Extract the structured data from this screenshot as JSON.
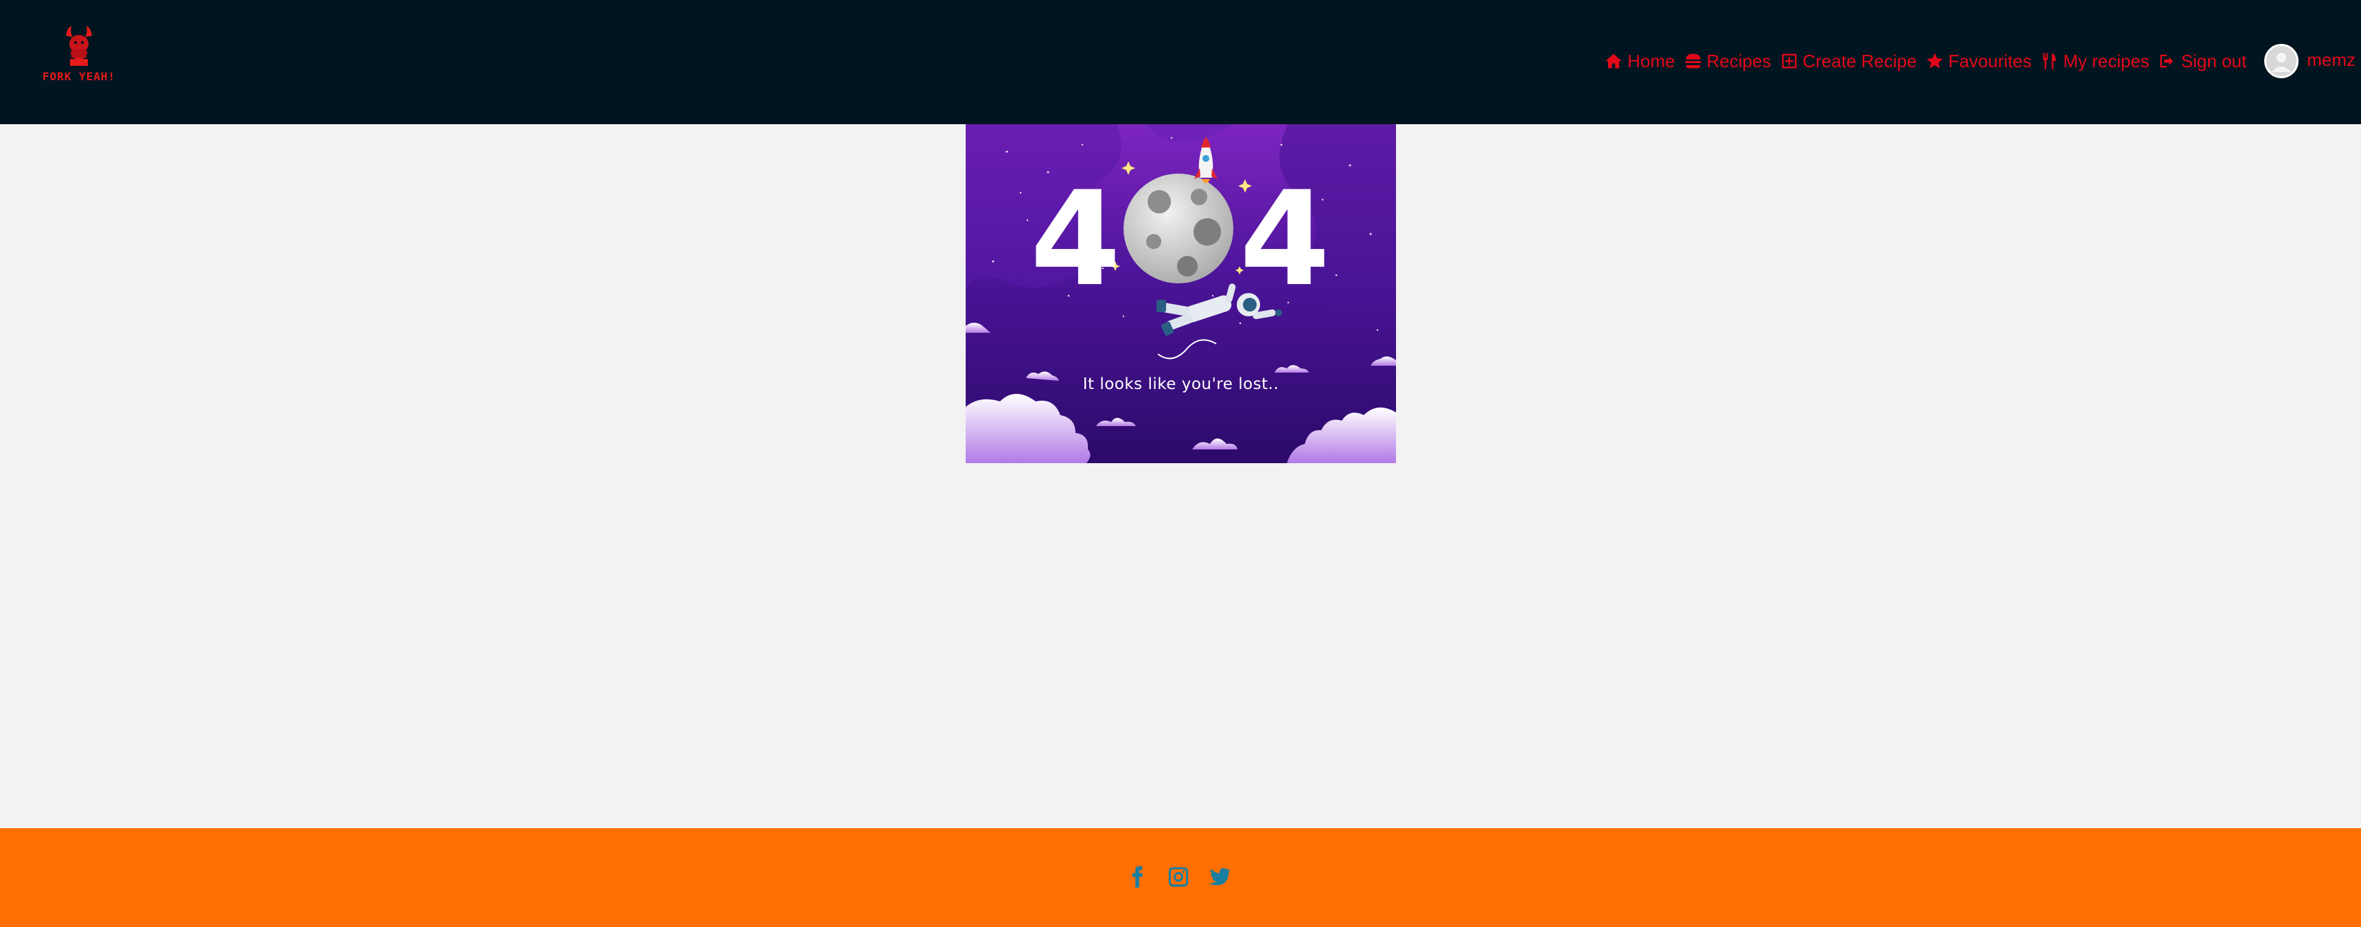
{
  "header": {
    "logo_text": "FORK YEAH!",
    "nav": [
      {
        "label": "Home",
        "icon": "home-icon"
      },
      {
        "label": "Recipes",
        "icon": "burger-icon"
      },
      {
        "label": "Create Recipe",
        "icon": "plus-square-icon"
      },
      {
        "label": "Favourites",
        "icon": "star-icon"
      },
      {
        "label": "My recipes",
        "icon": "utensils-icon"
      },
      {
        "label": "Sign out",
        "icon": "sign-out-icon"
      }
    ],
    "user": {
      "name": "memz",
      "avatar_icon": "user-avatar-icon"
    }
  },
  "notfound": {
    "digit_left": "4",
    "digit_right": "4",
    "message": "It looks like you're lost.."
  },
  "footer": {
    "social": [
      {
        "icon": "facebook-icon"
      },
      {
        "icon": "instagram-icon"
      },
      {
        "icon": "twitter-icon"
      }
    ]
  },
  "colors": {
    "header_bg": "#001520",
    "accent": "#e3081a",
    "page_bg": "#f2f2f2",
    "footer_bg": "#ff6f02",
    "social_icon": "#1a7fa0"
  }
}
